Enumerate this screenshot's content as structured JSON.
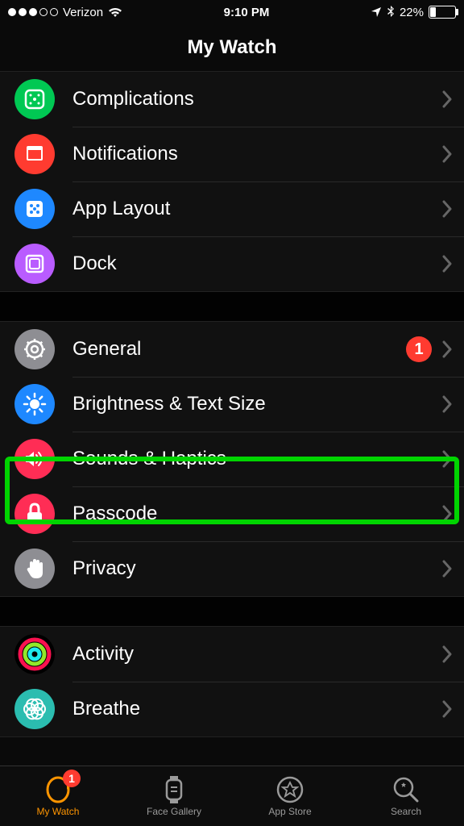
{
  "status": {
    "signal_filled": 3,
    "signal_total": 5,
    "carrier": "Verizon",
    "time": "9:10 PM",
    "battery_pct": "22%"
  },
  "header": {
    "title": "My Watch"
  },
  "groups": [
    {
      "rows": [
        {
          "id": "complications",
          "label": "Complications",
          "icon": "complications-icon",
          "icon_bg": "#00c853"
        },
        {
          "id": "notifications",
          "label": "Notifications",
          "icon": "notifications-icon",
          "icon_bg": "#ff3b30"
        },
        {
          "id": "app-layout",
          "label": "App Layout",
          "icon": "app-layout-icon",
          "icon_bg": "#1e88ff"
        },
        {
          "id": "dock",
          "label": "Dock",
          "icon": "dock-icon",
          "icon_bg": "#b95cff"
        }
      ]
    },
    {
      "rows": [
        {
          "id": "general",
          "label": "General",
          "icon": "gear-icon",
          "icon_bg": "#8e8e93",
          "badge": "1"
        },
        {
          "id": "brightness",
          "label": "Brightness & Text Size",
          "icon": "brightness-icon",
          "icon_bg": "#1e88ff"
        },
        {
          "id": "sounds",
          "label": "Sounds & Haptics",
          "icon": "speaker-icon",
          "icon_bg": "#ff2d55",
          "highlighted": true
        },
        {
          "id": "passcode",
          "label": "Passcode",
          "icon": "lock-icon",
          "icon_bg": "#ff2d55"
        },
        {
          "id": "privacy",
          "label": "Privacy",
          "icon": "hand-icon",
          "icon_bg": "#8e8e93"
        }
      ]
    },
    {
      "rows": [
        {
          "id": "activity",
          "label": "Activity",
          "icon": "activity-icon",
          "icon_bg": "#000"
        },
        {
          "id": "breathe",
          "label": "Breathe",
          "icon": "breathe-icon",
          "icon_bg": "#2bbdb0"
        }
      ]
    }
  ],
  "tabs": [
    {
      "id": "my-watch",
      "label": "My Watch",
      "active": true,
      "badge": "1"
    },
    {
      "id": "face-gallery",
      "label": "Face Gallery"
    },
    {
      "id": "app-store",
      "label": "App Store"
    },
    {
      "id": "search",
      "label": "Search"
    }
  ]
}
